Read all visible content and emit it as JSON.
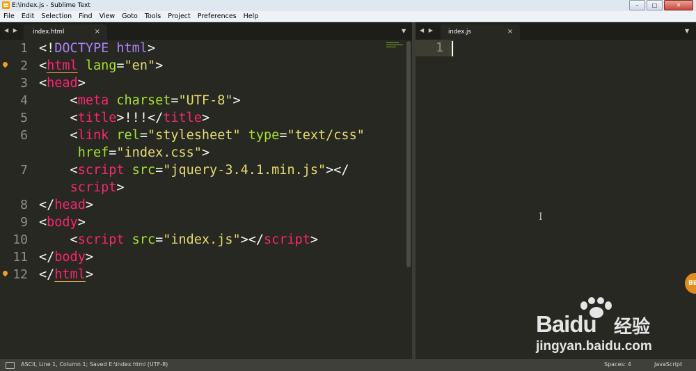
{
  "window": {
    "title": "E:\\index.js - Sublime Text",
    "minimize": "–",
    "maximize": "□",
    "close": "✕"
  },
  "menu": [
    "File",
    "Edit",
    "Selection",
    "Find",
    "View",
    "Goto",
    "Tools",
    "Project",
    "Preferences",
    "Help"
  ],
  "left_pane": {
    "nav": "◀ ▶",
    "tab": {
      "label": "index.html",
      "close": "×"
    },
    "dropdown": "▼",
    "line_numbers": [
      "1",
      "2",
      "3",
      "4",
      "5",
      "6",
      "",
      "7",
      "",
      "8",
      "9",
      "10",
      "11",
      "12"
    ],
    "lines": [
      [
        [
          "p",
          "<!"
        ],
        [
          "dt",
          "DOCTYPE"
        ],
        [
          "p",
          " "
        ],
        [
          "dt",
          "html"
        ],
        [
          "p",
          ">"
        ]
      ],
      [
        [
          "p",
          "<"
        ],
        [
          "tagu",
          "html"
        ],
        [
          "p",
          " "
        ],
        [
          "attr",
          "lang"
        ],
        [
          "p",
          "="
        ],
        [
          "str",
          "\"en\""
        ],
        [
          "p",
          ">"
        ]
      ],
      [
        [
          "p",
          "<"
        ],
        [
          "tag",
          "head"
        ],
        [
          "p",
          ">"
        ]
      ],
      [
        [
          "p",
          "    <"
        ],
        [
          "tag",
          "meta"
        ],
        [
          "p",
          " "
        ],
        [
          "attr",
          "charset"
        ],
        [
          "p",
          "="
        ],
        [
          "str",
          "\"UTF-8\""
        ],
        [
          "p",
          ">"
        ]
      ],
      [
        [
          "p",
          "    <"
        ],
        [
          "tag",
          "title"
        ],
        [
          "p",
          ">!!!</"
        ],
        [
          "tag",
          "title"
        ],
        [
          "p",
          ">"
        ]
      ],
      [
        [
          "p",
          "    <"
        ],
        [
          "tag",
          "link"
        ],
        [
          "p",
          " "
        ],
        [
          "attr",
          "rel"
        ],
        [
          "p",
          "="
        ],
        [
          "str",
          "\"stylesheet\""
        ],
        [
          "p",
          " "
        ],
        [
          "attr",
          "type"
        ],
        [
          "p",
          "="
        ],
        [
          "str",
          "\"text/css\""
        ]
      ],
      [
        [
          "p",
          "     "
        ],
        [
          "attr",
          "href"
        ],
        [
          "p",
          "="
        ],
        [
          "str",
          "\"index.css\""
        ],
        [
          "p",
          ">"
        ]
      ],
      [
        [
          "p",
          "    <"
        ],
        [
          "tag",
          "script"
        ],
        [
          "p",
          " "
        ],
        [
          "attr",
          "src"
        ],
        [
          "p",
          "="
        ],
        [
          "str",
          "\"jquery-3.4.1.min.js\""
        ],
        [
          "p",
          "></"
        ]
      ],
      [
        [
          "p",
          "    "
        ],
        [
          "tag",
          "script"
        ],
        [
          "p",
          ">"
        ]
      ],
      [
        [
          "p",
          "</"
        ],
        [
          "tag",
          "head"
        ],
        [
          "p",
          ">"
        ]
      ],
      [
        [
          "p",
          "<"
        ],
        [
          "tag",
          "body"
        ],
        [
          "p",
          ">"
        ]
      ],
      [
        [
          "p",
          "    <"
        ],
        [
          "tag",
          "script"
        ],
        [
          "p",
          " "
        ],
        [
          "attr",
          "src"
        ],
        [
          "p",
          "="
        ],
        [
          "str",
          "\"index.js\""
        ],
        [
          "p",
          "></"
        ],
        [
          "tag",
          "script"
        ],
        [
          "p",
          ">"
        ]
      ],
      [
        [
          "p",
          "</"
        ],
        [
          "tag",
          "body"
        ],
        [
          "p",
          ">"
        ]
      ],
      [
        [
          "p",
          "</"
        ],
        [
          "tagu",
          "html"
        ],
        [
          "p",
          ">"
        ]
      ]
    ]
  },
  "right_pane": {
    "nav": "◀ ▶",
    "tab": {
      "label": "index.js",
      "close": "×"
    },
    "dropdown": "▼",
    "line_number": "1",
    "ibeam": "I"
  },
  "notification_bubble": "BE",
  "watermark": {
    "brand": "Bai",
    "brand2": "du",
    "suffix": "经验",
    "url": "jingyan.baidu.com"
  },
  "status": {
    "left": "ASCII, Line 1, Column 1; Saved E:\\index.html (UTF-8)",
    "spaces": "Spaces: 4",
    "syntax": "JavaScript"
  },
  "colors": {
    "background": "#272822",
    "tag": "#f92672",
    "attribute": "#a6e22e",
    "string": "#e6db74",
    "doctype": "#ae81ff",
    "text": "#f8f8f2",
    "gutter": "#8f908a",
    "marker": "#f0a020"
  },
  "icons": [
    "sublime-text-icon",
    "minimize-icon",
    "maximize-icon",
    "close-icon",
    "nav-arrows-icon",
    "tab-close-icon",
    "dropdown-arrow-icon",
    "bookmark-marker-icon",
    "text-cursor-icon",
    "panel-toggle-icon",
    "baidu-paw-icon"
  ]
}
